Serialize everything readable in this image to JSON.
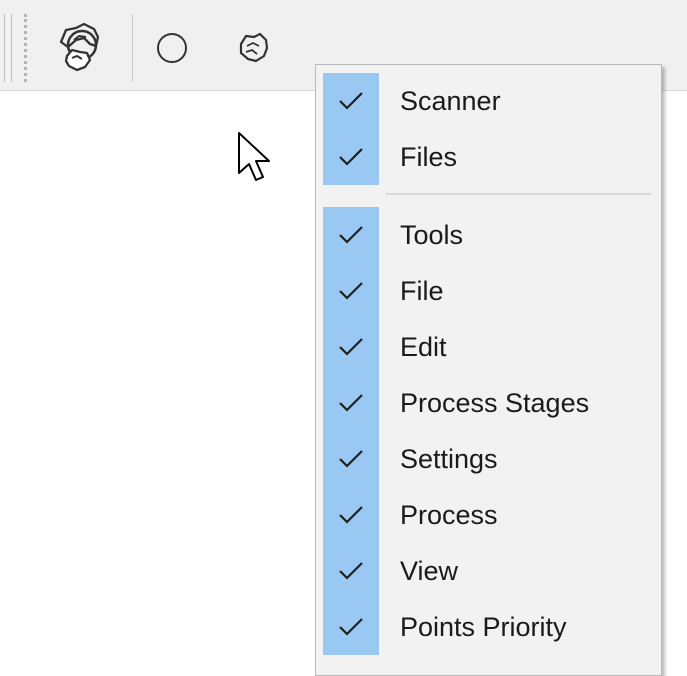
{
  "toolbar": {
    "buttons": [
      {
        "icon": "scanner-cluster-icon"
      },
      {
        "icon": "circle-icon"
      },
      {
        "icon": "rock-icon"
      }
    ]
  },
  "context_menu": {
    "check_color": "#99c9f3",
    "groups": [
      {
        "items": [
          {
            "label": "Scanner",
            "checked": true
          },
          {
            "label": "Files",
            "checked": true
          }
        ]
      },
      {
        "items": [
          {
            "label": "Tools",
            "checked": true
          },
          {
            "label": "File",
            "checked": true
          },
          {
            "label": "Edit",
            "checked": true
          },
          {
            "label": "Process Stages",
            "checked": true
          },
          {
            "label": "Settings",
            "checked": true
          },
          {
            "label": "Process",
            "checked": true
          },
          {
            "label": "View",
            "checked": true
          },
          {
            "label": "Points Priority",
            "checked": true
          }
        ]
      }
    ]
  }
}
